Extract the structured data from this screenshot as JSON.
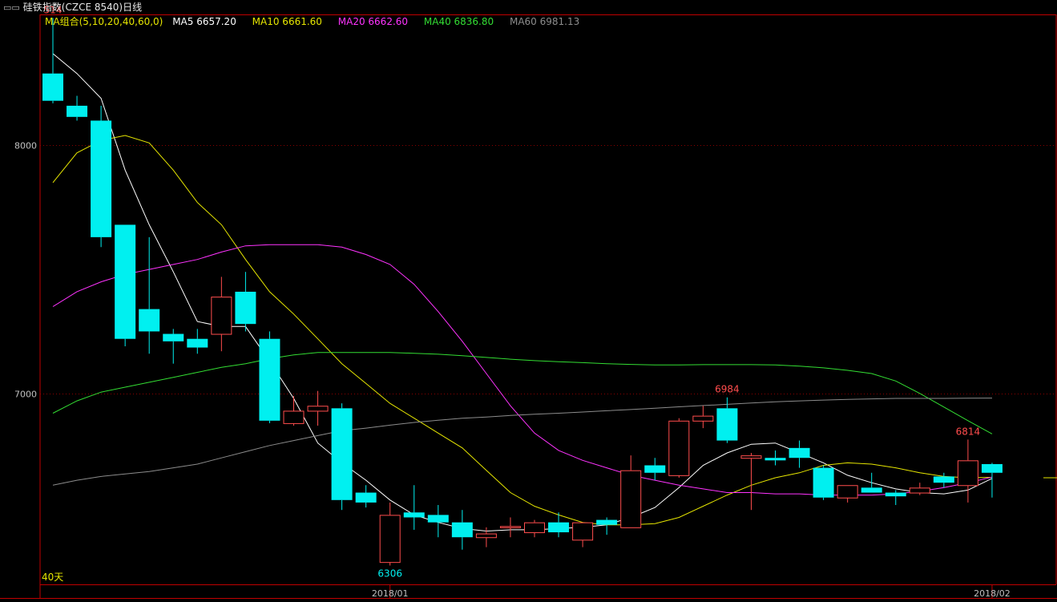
{
  "window": {
    "title": "硅铁指数(CZCE 8540)日线",
    "title_icon": "window-toggle-icon"
  },
  "legend": {
    "label": "MA组合(5,10,20,40,60,0)",
    "label_color": "#e6e600",
    "items": [
      {
        "text": "MA5 6657.20",
        "color": "#ffffff"
      },
      {
        "text": "MA10 6661.60",
        "color": "#e6e600"
      },
      {
        "text": "MA20 6662.60",
        "color": "#ff33ff"
      },
      {
        "text": "MA40 6836.80",
        "color": "#33dd33"
      },
      {
        "text": "MA60 6981.13",
        "color": "#8c8c8c"
      }
    ]
  },
  "colors": {
    "up": "#ff4d4d",
    "down": "#00f0f0",
    "grid": "#8b0000",
    "axis": "#c00000",
    "text": "#c0c0c0"
  },
  "chart_data": {
    "type": "candlestick",
    "ylim": [
      6230,
      8470
    ],
    "y_ticks": [
      7000,
      8000
    ],
    "x_ticks": [
      {
        "index": 14,
        "label": "2018/01"
      },
      {
        "index": 39,
        "label": "2018/02"
      }
    ],
    "period_label": "40天",
    "annotations": [
      {
        "index": 0,
        "price": 8514,
        "text": "514",
        "color": "#ff4d4d",
        "pos": "above"
      },
      {
        "index": 14,
        "price": 6306,
        "text": "6306",
        "color": "#00f0f0",
        "pos": "below"
      },
      {
        "index": 28,
        "price": 6984,
        "text": "6984",
        "color": "#ff4d4d",
        "pos": "above"
      },
      {
        "index": 38,
        "price": 6814,
        "text": "6814",
        "color": "#ff4d4d",
        "pos": "above"
      }
    ],
    "candles": [
      {
        "o": 8290,
        "h": 8514,
        "l": 8170,
        "c": 8180
      },
      {
        "o": 8160,
        "h": 8200,
        "l": 8100,
        "c": 8115
      },
      {
        "o": 8100,
        "h": 8160,
        "l": 7590,
        "c": 7630
      },
      {
        "o": 7680,
        "h": 7680,
        "l": 7190,
        "c": 7220
      },
      {
        "o": 7340,
        "h": 7630,
        "l": 7160,
        "c": 7250
      },
      {
        "o": 7240,
        "h": 7260,
        "l": 7120,
        "c": 7210
      },
      {
        "o": 7220,
        "h": 7260,
        "l": 7160,
        "c": 7185
      },
      {
        "o": 7240,
        "h": 7470,
        "l": 7170,
        "c": 7390
      },
      {
        "o": 7410,
        "h": 7490,
        "l": 7250,
        "c": 7280
      },
      {
        "o": 7220,
        "h": 7250,
        "l": 6880,
        "c": 6890
      },
      {
        "o": 6880,
        "h": 6990,
        "l": 6870,
        "c": 6930
      },
      {
        "o": 6930,
        "h": 7010,
        "l": 6870,
        "c": 6950
      },
      {
        "o": 6940,
        "h": 6960,
        "l": 6530,
        "c": 6570
      },
      {
        "o": 6600,
        "h": 6630,
        "l": 6540,
        "c": 6560
      },
      {
        "o": 6320,
        "h": 6560,
        "l": 6306,
        "c": 6510
      },
      {
        "o": 6520,
        "h": 6630,
        "l": 6450,
        "c": 6500
      },
      {
        "o": 6510,
        "h": 6550,
        "l": 6420,
        "c": 6480
      },
      {
        "o": 6480,
        "h": 6530,
        "l": 6370,
        "c": 6420
      },
      {
        "o": 6420,
        "h": 6460,
        "l": 6380,
        "c": 6435
      },
      {
        "o": 6460,
        "h": 6500,
        "l": 6420,
        "c": 6465
      },
      {
        "o": 6440,
        "h": 6490,
        "l": 6420,
        "c": 6480
      },
      {
        "o": 6480,
        "h": 6520,
        "l": 6420,
        "c": 6440
      },
      {
        "o": 6410,
        "h": 6480,
        "l": 6380,
        "c": 6480
      },
      {
        "o": 6490,
        "h": 6500,
        "l": 6430,
        "c": 6470
      },
      {
        "o": 6460,
        "h": 6750,
        "l": 6460,
        "c": 6690
      },
      {
        "o": 6710,
        "h": 6740,
        "l": 6650,
        "c": 6680
      },
      {
        "o": 6670,
        "h": 6900,
        "l": 6660,
        "c": 6890
      },
      {
        "o": 6890,
        "h": 6950,
        "l": 6860,
        "c": 6910
      },
      {
        "o": 6940,
        "h": 6984,
        "l": 6800,
        "c": 6810
      },
      {
        "o": 6740,
        "h": 6760,
        "l": 6530,
        "c": 6750
      },
      {
        "o": 6740,
        "h": 6770,
        "l": 6710,
        "c": 6730
      },
      {
        "o": 6780,
        "h": 6810,
        "l": 6700,
        "c": 6740
      },
      {
        "o": 6700,
        "h": 6710,
        "l": 6570,
        "c": 6580
      },
      {
        "o": 6580,
        "h": 6630,
        "l": 6560,
        "c": 6630
      },
      {
        "o": 6620,
        "h": 6680,
        "l": 6600,
        "c": 6600
      },
      {
        "o": 6600,
        "h": 6610,
        "l": 6550,
        "c": 6585
      },
      {
        "o": 6600,
        "h": 6640,
        "l": 6590,
        "c": 6620
      },
      {
        "o": 6665,
        "h": 6680,
        "l": 6620,
        "c": 6640
      },
      {
        "o": 6630,
        "h": 6814,
        "l": 6560,
        "c": 6730
      },
      {
        "o": 6715,
        "h": 6720,
        "l": 6580,
        "c": 6680
      }
    ],
    "series": [
      {
        "name": "MA5",
        "color": "#ffffff",
        "values": [
          8370,
          8290,
          8190,
          7900,
          7680,
          7490,
          7290,
          7270,
          7270,
          7130,
          6980,
          6800,
          6720,
          6650,
          6570,
          6510,
          6480,
          6455,
          6445,
          6450,
          6450,
          6455,
          6460,
          6470,
          6500,
          6540,
          6620,
          6710,
          6760,
          6795,
          6800,
          6760,
          6720,
          6670,
          6640,
          6615,
          6600,
          6595,
          6610,
          6657.2
        ]
      },
      {
        "name": "MA10",
        "color": "#e6e600",
        "values": [
          7850,
          7970,
          8020,
          8040,
          8010,
          7900,
          7770,
          7680,
          7540,
          7410,
          7320,
          7220,
          7120,
          7040,
          6960,
          6900,
          6840,
          6780,
          6690,
          6600,
          6545,
          6510,
          6480,
          6470,
          6470,
          6475,
          6500,
          6545,
          6590,
          6630,
          6660,
          6680,
          6710,
          6720,
          6715,
          6700,
          6680,
          6665,
          6660,
          6661.6
        ]
      },
      {
        "name": "MA20",
        "color": "#ff33ff",
        "values": [
          7350,
          7410,
          7450,
          7480,
          7500,
          7520,
          7540,
          7570,
          7595,
          7600,
          7600,
          7600,
          7590,
          7560,
          7520,
          7440,
          7330,
          7210,
          7080,
          6950,
          6840,
          6770,
          6730,
          6700,
          6670,
          6650,
          6630,
          6615,
          6600,
          6600,
          6595,
          6595,
          6590,
          6590,
          6590,
          6595,
          6605,
          6620,
          6640,
          6662.6
        ]
      },
      {
        "name": "MA40",
        "color": "#33dd33",
        "values": [
          6920,
          6970,
          7005,
          7025,
          7045,
          7065,
          7085,
          7105,
          7120,
          7140,
          7155,
          7165,
          7165,
          7165,
          7165,
          7162,
          7158,
          7152,
          7145,
          7138,
          7132,
          7128,
          7124,
          7120,
          7117,
          7115,
          7115,
          7116,
          7116,
          7116,
          7115,
          7110,
          7103,
          7093,
          7080,
          7050,
          7000,
          6945,
          6890,
          6836.8
        ]
      },
      {
        "name": "MA60",
        "color": "#8c8c8c",
        "values": [
          6630,
          6650,
          6665,
          6675,
          6685,
          6700,
          6715,
          6740,
          6765,
          6790,
          6810,
          6830,
          6850,
          6860,
          6872,
          6883,
          6892,
          6900,
          6905,
          6911,
          6916,
          6920,
          6925,
          6930,
          6935,
          6940,
          6946,
          6951,
          6956,
          6961,
          6966,
          6970,
          6973,
          6976,
          6978,
          6980,
          6980,
          6980,
          6981,
          6981.13
        ]
      }
    ],
    "tail_line": {
      "color": "#e6e600",
      "price": 6660
    }
  }
}
